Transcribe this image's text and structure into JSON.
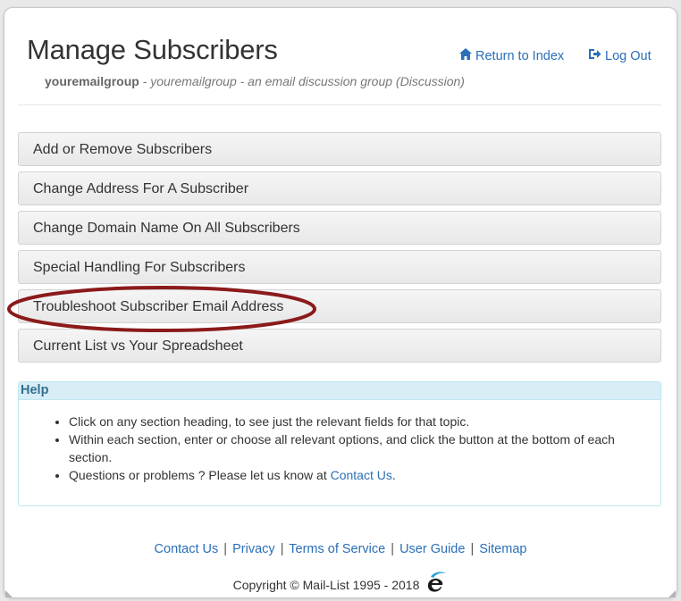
{
  "header": {
    "title": "Manage Subscribers",
    "group_name": "youremailgroup",
    "group_description": " - youremailgroup - an email discussion group (Discussion)",
    "return_label": "Return to Index",
    "logout_label": "Log Out",
    "home_icon": "home-icon",
    "logout_icon": "logout-icon"
  },
  "sections": [
    {
      "label": "Add or Remove Subscribers"
    },
    {
      "label": "Change Address For A Subscriber"
    },
    {
      "label": "Change Domain Name On All Subscribers"
    },
    {
      "label": "Special Handling For Subscribers"
    },
    {
      "label": "Troubleshoot Subscriber Email Address"
    },
    {
      "label": "Current List vs Your Spreadsheet"
    }
  ],
  "help": {
    "heading": "Help",
    "items": [
      "Click on any section heading, to see just the relevant fields for that topic.",
      "Within each section, enter or choose all relevant options, and click the button at the bottom of each section."
    ],
    "item3_prefix": "Questions or problems ? Please let us know at ",
    "item3_link": "Contact Us",
    "item3_suffix": "."
  },
  "footer": {
    "links": [
      "Contact Us",
      "Privacy",
      "Terms of Service",
      "User Guide",
      "Sitemap"
    ],
    "separator": "|",
    "copyright": "Copyright © Mail-List 1995 - 2018"
  },
  "colors": {
    "link": "#2a6fb8",
    "annotation": "#8b1a1a",
    "help_bg": "#d9edf7"
  }
}
